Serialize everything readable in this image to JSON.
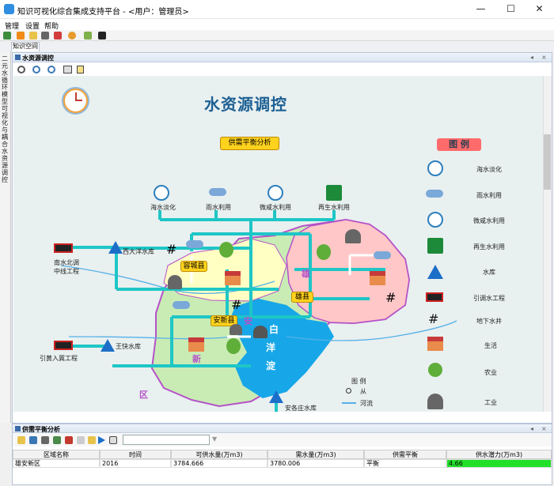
{
  "window": {
    "title": "知识可视化综合集成支持平台 - <用户：管理员>",
    "min_glyph": "—",
    "max_glyph": "☐",
    "close_glyph": "✕"
  },
  "menu": [
    "管理",
    "设置",
    "帮助"
  ],
  "tab": {
    "label": "知识空间"
  },
  "side_panel_label": "二元水循环模型可视化与耦合水资源调控",
  "panel": {
    "title": "水资源调控",
    "pin": "◂",
    "close": "×"
  },
  "map": {
    "title": "水资源调控",
    "analysis_button": "供需平衡分析",
    "legend_title": "图 例",
    "legend_items": [
      {
        "icon": "desalination-icon",
        "label": "海水淡化"
      },
      {
        "icon": "rainwater-icon",
        "label": "雨水利用"
      },
      {
        "icon": "brackish-water-icon",
        "label": "微咸水利用"
      },
      {
        "icon": "recycled-water-icon",
        "label": "再生水利用"
      },
      {
        "icon": "reservoir-icon",
        "label": "水库"
      },
      {
        "icon": "diversion-icon",
        "label": "引调水工程"
      },
      {
        "icon": "groundwater-well-icon",
        "label": "地下水井"
      },
      {
        "icon": "residential-icon",
        "label": "生活"
      },
      {
        "icon": "agriculture-icon",
        "label": "农业"
      },
      {
        "icon": "industry-icon",
        "label": "工业"
      }
    ],
    "sources": [
      "海水淡化",
      "雨水利用",
      "微咸水利用",
      "再生水利用"
    ],
    "counties": {
      "rongcheng": "容城县",
      "anxin": "安新县",
      "xiongxian": "雄县"
    },
    "region_chars": {
      "an": "安",
      "xin": "新",
      "qu": "区",
      "xiong": "雄"
    },
    "lake_chars": {
      "bai": "白",
      "yang": "洋",
      "dian": "淀"
    },
    "reservoirs": {
      "xidayang": "西大洋水库",
      "wangkuai": "王快水库",
      "angezhuang": "安各庄水库"
    },
    "diversions": {
      "nanshui": "南水北调\n中线工程",
      "yinhuang": "引黄入冀工程"
    },
    "inner_legend_title": "图    例",
    "inner_legend_items": [
      "从",
      "河流"
    ]
  },
  "bottom": {
    "title": "供需平衡分析",
    "search_placeholder": "",
    "columns": [
      "区域名称",
      "时间",
      "可供水量(万m3)",
      "需水量(万m3)",
      "供需平衡",
      "供水潜力(万m3)"
    ],
    "row": [
      "雄安新区",
      "2016",
      "3784.666",
      "3780.006",
      "平衡",
      "4.66"
    ]
  },
  "colors": {
    "potential_fill": "#22e02a",
    "pipe": "#1ec6c6",
    "region_pink": "#ffc7c7",
    "region_green": "#c9ecb5",
    "lake": "#17a7e8"
  }
}
